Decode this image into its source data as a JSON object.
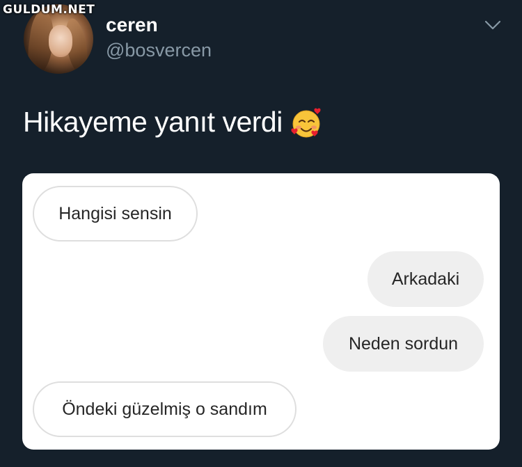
{
  "watermark": "GULDUM.NET",
  "user": {
    "name": "ceren",
    "handle": "@bosvercen"
  },
  "tweet": {
    "text": "Hikayeme yanıt verdi",
    "emoji": "smiling-face-with-hearts"
  },
  "messages": [
    {
      "text": "Hangisi sensin",
      "side": "received"
    },
    {
      "text": "Arkadaki",
      "side": "sent"
    },
    {
      "text": "Neden sordun",
      "side": "sent"
    },
    {
      "text": "Öndeki güzelmiş o sandım",
      "side": "received"
    }
  ],
  "colors": {
    "background": "#15202b",
    "name": "#ffffff",
    "handle": "#8899a6",
    "card": "#ffffff",
    "sent_bubble": "#efefef",
    "received_border": "#dedede"
  }
}
